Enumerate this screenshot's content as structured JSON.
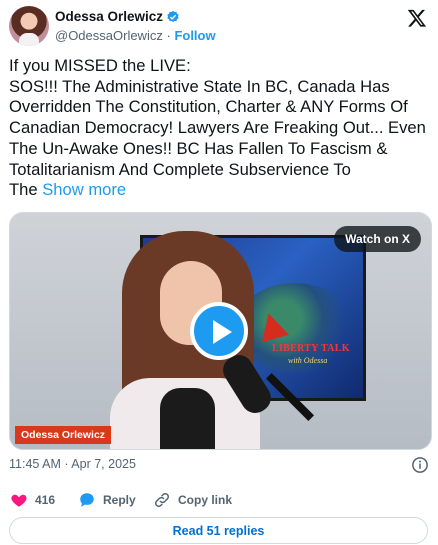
{
  "author": {
    "name": "Odessa Orlewicz",
    "handle": "@OdessaOrlewicz",
    "separator": "·",
    "follow_label": "Follow"
  },
  "post": {
    "text": "If you MISSED the LIVE:\nSOS!!! The Administrative State In BC, Canada Has Overridden The Constitution, Charter & ANY Forms Of Canadian Democracy! Lawyers Are Freaking Out... Even The Un-Awake Ones!! BC Has Fallen To Fascism & Totalitarianism And Complete Subservience To\nThe ",
    "show_more": "Show more"
  },
  "media": {
    "watch_label": "Watch on X",
    "name_tag": "Odessa Orlewicz",
    "brand_text": "LIBERTY TALK",
    "brand_sub": "with Odessa"
  },
  "timestamp": "11:45 AM · Apr 7, 2025",
  "actions": {
    "likes": "416",
    "reply_label": "Reply",
    "copy_label": "Copy link"
  },
  "replies_button": "Read 51 replies",
  "colors": {
    "accent": "#1d9bf0",
    "like": "#f91880",
    "muted": "#536471"
  }
}
